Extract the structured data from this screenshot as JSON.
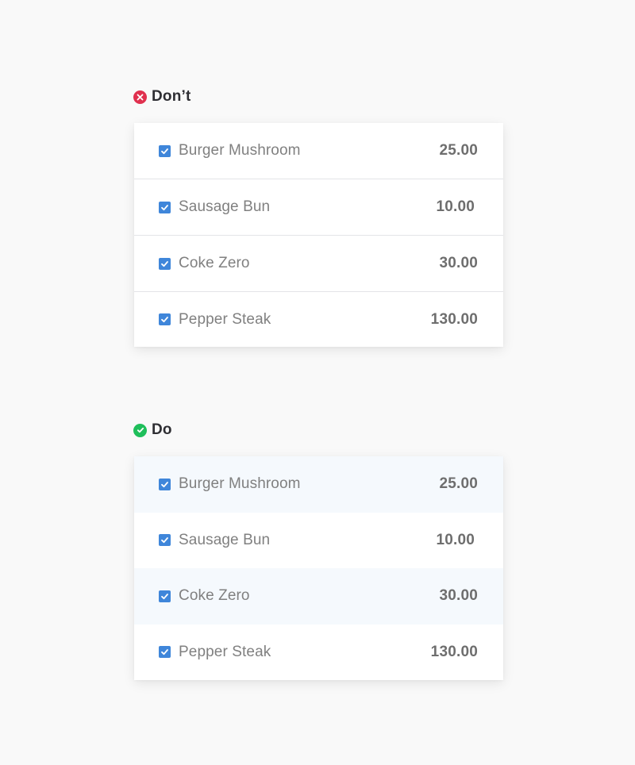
{
  "sections": {
    "dont": {
      "label": "Don’t",
      "icon": "x-circle-icon",
      "icon_color": "#e0304e",
      "rows": [
        {
          "name": "Burger Mushroom",
          "price": "25.00",
          "checked": true
        },
        {
          "name": "Sausage Bun",
          "price": "10.00",
          "checked": true
        },
        {
          "name": "Coke Zero",
          "price": "30.00",
          "checked": true
        },
        {
          "name": "Pepper Steak",
          "price": "130.00",
          "checked": true
        }
      ]
    },
    "do": {
      "label": "Do",
      "icon": "check-circle-icon",
      "icon_color": "#1fbf5b",
      "stripe_color": "#f5f9fd",
      "rows": [
        {
          "name": "Burger Mushroom",
          "price": "25.00",
          "checked": true
        },
        {
          "name": "Sausage Bun",
          "price": "10.00",
          "checked": true
        },
        {
          "name": "Coke Zero",
          "price": "30.00",
          "checked": true
        },
        {
          "name": "Pepper Steak",
          "price": "130.00",
          "checked": true
        }
      ]
    }
  },
  "colors": {
    "background": "#f9f9f9",
    "checkbox": "#3f86da",
    "divider": "#e3e4e7",
    "item_text": "#808080",
    "price_text": "#6e6e6e"
  }
}
